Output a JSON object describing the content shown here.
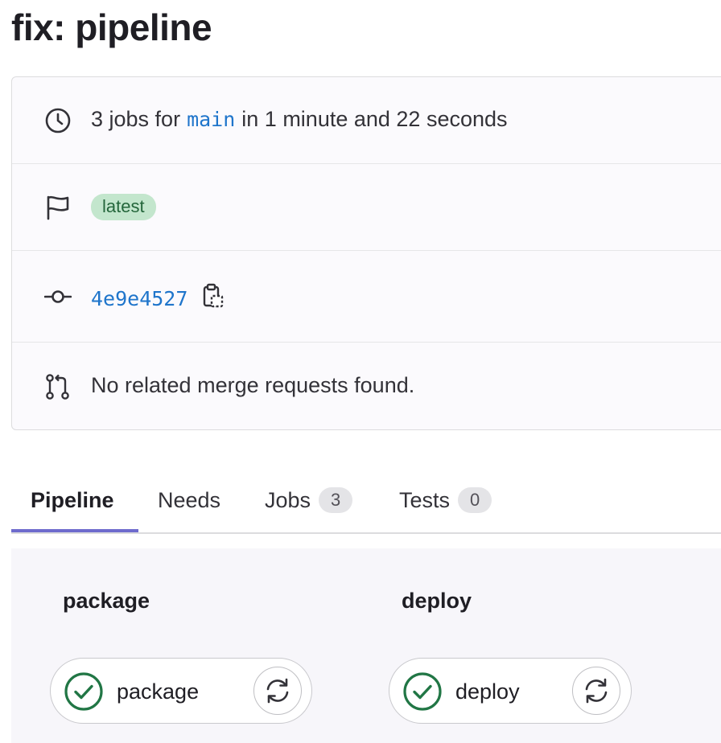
{
  "page": {
    "title": "fix: pipeline"
  },
  "info": {
    "jobs_summary_prefix": "3 jobs for",
    "branch": "main",
    "jobs_summary_suffix": "in 1 minute and 22 seconds",
    "badge": "latest",
    "commit_sha": "4e9e4527",
    "merge_requests": "No related merge requests found."
  },
  "icons": {
    "clock": "clock-icon",
    "flag": "flag-icon",
    "commit": "commit-icon",
    "copy": "copy-to-clipboard-icon",
    "merge_request": "merge-request-icon",
    "status_success": "status-success-icon",
    "retry": "retry-icon"
  },
  "tabs": [
    {
      "label": "Pipeline",
      "active": true
    },
    {
      "label": "Needs"
    },
    {
      "label": "Jobs",
      "count": "3"
    },
    {
      "label": "Tests",
      "count": "0"
    }
  ],
  "stages": [
    {
      "name": "package",
      "jobs": [
        {
          "name": "package",
          "status": "success"
        }
      ]
    },
    {
      "name": "deploy",
      "jobs": [
        {
          "name": "deploy",
          "status": "success"
        }
      ]
    }
  ],
  "colors": {
    "link": "#1f75cb",
    "success": "#217645",
    "badge_bg": "#c3e6cd",
    "tab_underline": "#6e6bcd"
  }
}
